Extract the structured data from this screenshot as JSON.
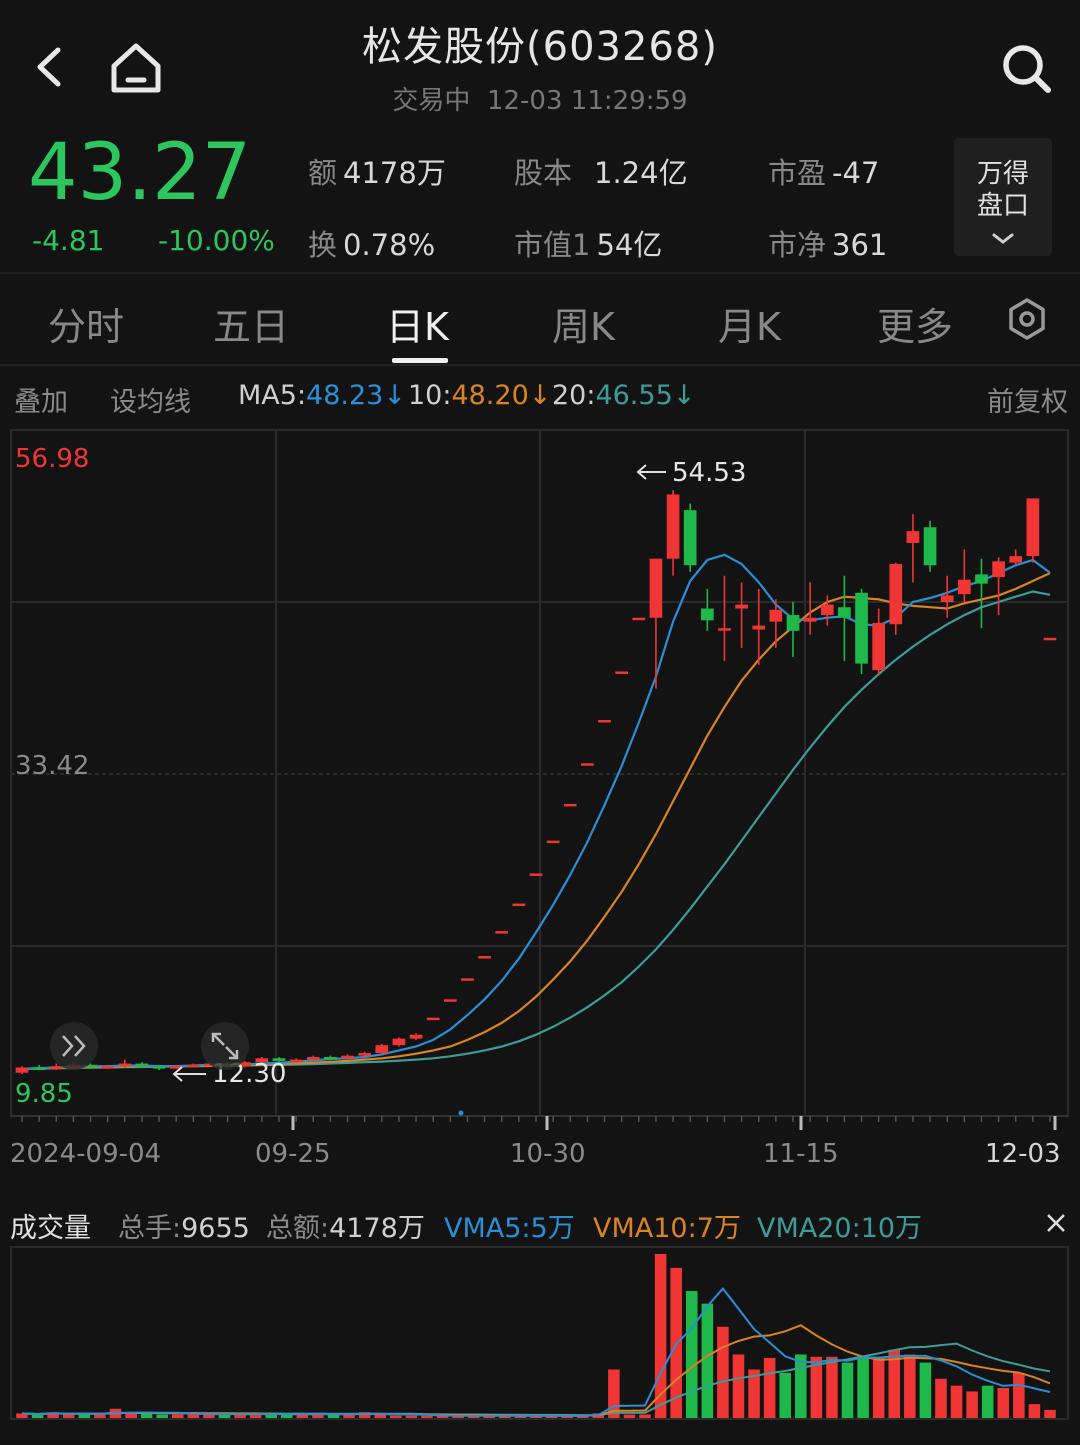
{
  "header": {
    "title": "松发股份(603268)",
    "status": "交易中",
    "datetime": "12-03 11:29:59"
  },
  "quote": {
    "price": "43.27",
    "change": "-4.81",
    "change_pct": "-10.00%",
    "amount_label": "额",
    "amount": "4178万",
    "turnover_label": "换",
    "turnover": "0.78%",
    "share_cap_label": "股本",
    "share_cap": "1.24亿",
    "mkt_cap_label": "市值1",
    "mkt_cap": "54亿",
    "pe_label": "市盈",
    "pe": "-47",
    "pb_label": "市净",
    "pb": "361",
    "wind_button": [
      "万得",
      "盘口"
    ]
  },
  "tabs": [
    {
      "label": "分时",
      "active": false
    },
    {
      "label": "五日",
      "active": false
    },
    {
      "label": "日K",
      "active": true
    },
    {
      "label": "周K",
      "active": false
    },
    {
      "label": "月K",
      "active": false
    },
    {
      "label": "更多",
      "active": false
    }
  ],
  "ma_row": {
    "overlay": "叠加",
    "set_ma": "设均线",
    "ma5_label": "MA5:",
    "ma5": "48.23",
    "ma10_label": "10:",
    "ma10": "48.20",
    "ma20_label": "20:",
    "ma20": "46.55",
    "arrow": "↓",
    "adjust": "前复权"
  },
  "colors": {
    "up": "#f03535",
    "down": "#1fb84a",
    "ma5": "#2a8fd6",
    "ma10": "#d98424",
    "ma20": "#3d9c98",
    "grid": "#2a2a2a"
  },
  "chart_data": {
    "type": "candlestick",
    "y_range": [
      9.85,
      56.98
    ],
    "y_ticks": [
      "56.98",
      "33.42",
      "9.85"
    ],
    "x_ticks": [
      "2024-09-04",
      "09-25",
      "10-30",
      "11-15",
      "12-03"
    ],
    "max_label": "54.53",
    "min_label": "12.30",
    "candles": [
      [
        10.1,
        10.5,
        10.0,
        10.6
      ],
      [
        10.5,
        10.4,
        10.3,
        10.7
      ],
      [
        10.4,
        10.6,
        10.3,
        10.8
      ],
      [
        10.6,
        10.7,
        10.5,
        10.9
      ],
      [
        10.7,
        10.5,
        10.4,
        10.8
      ],
      [
        10.5,
        10.6,
        10.4,
        10.7
      ],
      [
        10.6,
        10.8,
        10.5,
        11.1
      ],
      [
        10.8,
        10.6,
        10.5,
        10.9
      ],
      [
        10.6,
        10.5,
        10.3,
        10.7
      ],
      [
        10.5,
        10.6,
        10.4,
        10.7
      ],
      [
        10.6,
        10.7,
        10.5,
        10.8
      ],
      [
        10.7,
        10.8,
        10.6,
        10.9
      ],
      [
        10.8,
        10.6,
        10.5,
        10.9
      ],
      [
        10.6,
        10.9,
        10.5,
        11.0
      ],
      [
        10.9,
        11.2,
        10.8,
        11.3
      ],
      [
        11.2,
        11.0,
        10.9,
        11.3
      ],
      [
        11.0,
        11.1,
        10.9,
        11.2
      ],
      [
        11.1,
        11.3,
        11.0,
        11.4
      ],
      [
        11.3,
        11.2,
        11.1,
        11.4
      ],
      [
        11.2,
        11.4,
        11.1,
        11.5
      ],
      [
        11.4,
        11.6,
        11.3,
        11.7
      ],
      [
        11.6,
        12.2,
        11.5,
        12.3
      ],
      [
        12.2,
        12.7,
        12.1,
        12.8
      ],
      [
        12.7,
        13.0,
        12.6,
        13.1
      ],
      [
        14.3,
        14.3,
        14.3,
        14.3
      ],
      [
        15.7,
        15.7,
        15.7,
        15.7
      ],
      [
        17.3,
        17.3,
        17.3,
        17.3
      ],
      [
        19.0,
        19.0,
        19.0,
        19.0
      ],
      [
        20.9,
        20.9,
        20.9,
        20.9
      ],
      [
        23.0,
        23.0,
        23.0,
        23.0
      ],
      [
        25.3,
        25.3,
        25.3,
        25.3
      ],
      [
        27.8,
        27.8,
        27.8,
        27.8
      ],
      [
        30.6,
        30.6,
        30.6,
        30.6
      ],
      [
        33.7,
        33.7,
        33.7,
        33.7
      ],
      [
        37.0,
        37.0,
        37.0,
        37.0
      ],
      [
        40.7,
        40.7,
        40.7,
        40.7
      ],
      [
        44.8,
        44.8,
        44.8,
        44.8
      ],
      [
        44.8,
        49.3,
        39.4,
        49.3
      ],
      [
        49.3,
        54.2,
        48.0,
        54.53
      ],
      [
        53.0,
        48.8,
        48.3,
        53.5
      ],
      [
        45.5,
        44.6,
        43.8,
        47.0
      ],
      [
        44.0,
        44.0,
        41.5,
        48.0
      ],
      [
        45.5,
        45.8,
        42.5,
        47.5
      ],
      [
        43.9,
        44.2,
        41.2,
        47.0
      ],
      [
        44.5,
        45.4,
        42.5,
        46.2
      ],
      [
        45.0,
        43.8,
        41.8,
        46.0
      ],
      [
        44.5,
        44.8,
        43.5,
        47.5
      ],
      [
        45.0,
        45.8,
        44.2,
        46.5
      ],
      [
        45.6,
        44.8,
        41.5,
        48.0
      ],
      [
        46.7,
        41.3,
        40.5,
        47.0
      ],
      [
        40.8,
        44.4,
        40.5,
        45.5
      ],
      [
        44.3,
        48.9,
        43.5,
        49.0
      ],
      [
        50.5,
        51.4,
        47.5,
        52.7
      ],
      [
        51.7,
        48.8,
        48.3,
        52.2
      ],
      [
        46.0,
        46.5,
        44.8,
        48.0
      ],
      [
        46.6,
        47.7,
        46.0,
        50.0
      ],
      [
        48.1,
        47.4,
        44.0,
        49.3
      ],
      [
        47.9,
        49.1,
        45.0,
        49.4
      ],
      [
        49.0,
        49.5,
        48.8,
        50.0
      ],
      [
        49.5,
        53.9,
        49.0,
        53.9
      ],
      [
        43.27,
        43.27,
        43.27,
        43.27
      ]
    ],
    "ma5": [
      10.4,
      10.45,
      10.5,
      10.55,
      10.6,
      10.6,
      10.65,
      10.65,
      10.6,
      10.6,
      10.65,
      10.7,
      10.7,
      10.72,
      10.8,
      10.85,
      10.95,
      11.05,
      11.15,
      11.2,
      11.3,
      11.5,
      11.8,
      12.1,
      12.6,
      13.4,
      14.5,
      15.7,
      17.1,
      18.8,
      20.8,
      22.9,
      25.2,
      27.7,
      30.5,
      33.5,
      36.8,
      40.3,
      44.5,
      47.6,
      49.2,
      49.6,
      48.9,
      47.5,
      45.8,
      44.7,
      44.6,
      44.8,
      44.9,
      44.3,
      44.2,
      44.8,
      46.0,
      46.3,
      46.7,
      47.2,
      47.6,
      48.2,
      48.8,
      49.2,
      48.23
    ],
    "ma10": [
      10.4,
      10.43,
      10.46,
      10.5,
      10.52,
      10.55,
      10.57,
      10.6,
      10.6,
      10.6,
      10.6,
      10.62,
      10.64,
      10.66,
      10.7,
      10.75,
      10.8,
      10.87,
      10.93,
      11.0,
      11.1,
      11.2,
      11.35,
      11.55,
      11.8,
      12.1,
      12.6,
      13.2,
      13.9,
      14.8,
      15.9,
      17.2,
      18.6,
      20.2,
      22.0,
      23.9,
      26.0,
      28.3,
      30.8,
      33.3,
      35.8,
      38.0,
      40.0,
      41.6,
      43.0,
      44.1,
      45.2,
      46.0,
      46.4,
      46.3,
      46.2,
      45.9,
      45.7,
      45.6,
      45.5,
      45.9,
      46.2,
      46.5,
      47.0,
      47.6,
      48.2
    ],
    "ma20": [
      10.4,
      10.42,
      10.44,
      10.46,
      10.48,
      10.5,
      10.52,
      10.54,
      10.56,
      10.58,
      10.6,
      10.62,
      10.64,
      10.66,
      10.68,
      10.7,
      10.73,
      10.76,
      10.8,
      10.85,
      10.9,
      10.95,
      11.02,
      11.1,
      11.2,
      11.35,
      11.55,
      11.8,
      12.1,
      12.5,
      13.0,
      13.6,
      14.3,
      15.1,
      16.0,
      17.0,
      18.2,
      19.5,
      21.0,
      22.6,
      24.3,
      26.0,
      27.8,
      29.6,
      31.4,
      33.2,
      34.9,
      36.5,
      38.0,
      39.3,
      40.5,
      41.6,
      42.6,
      43.5,
      44.3,
      45.0,
      45.6,
      46.0,
      46.4,
      46.8,
      46.55
    ]
  },
  "volume": {
    "title": "成交量",
    "total_hands_label": "总手:",
    "total_hands": "9655",
    "total_amount_label": "总额:",
    "total_amount": "4178万",
    "vma5": "VMA5:5万",
    "vma10": "VMA10:7万",
    "vma20": "VMA20:10万",
    "bars": [
      0.4,
      0.3,
      0.5,
      0.3,
      0.4,
      0.3,
      0.8,
      0.5,
      0.4,
      0.3,
      0.3,
      0.4,
      0.3,
      0.4,
      0.3,
      0.3,
      0.4,
      0.3,
      0.3,
      0.4,
      0.3,
      0.3,
      0.5,
      0.3,
      0.2,
      0.2,
      0.2,
      0.2,
      0.2,
      0.2,
      0.2,
      0.2,
      0.2,
      0.2,
      0.2,
      0.2,
      0.2,
      0.4,
      4.2,
      0.3,
      0.3,
      14.2,
      13.0,
      11.0,
      9.9,
      7.9,
      5.5,
      4.2,
      5.2,
      3.9,
      5.5,
      5.3,
      5.3,
      4.8,
      5.4,
      5.3,
      5.9,
      5.5,
      4.8,
      3.4,
      2.8,
      2.3,
      2.8,
      2.6,
      3.9,
      1.2,
      0.7
    ]
  }
}
